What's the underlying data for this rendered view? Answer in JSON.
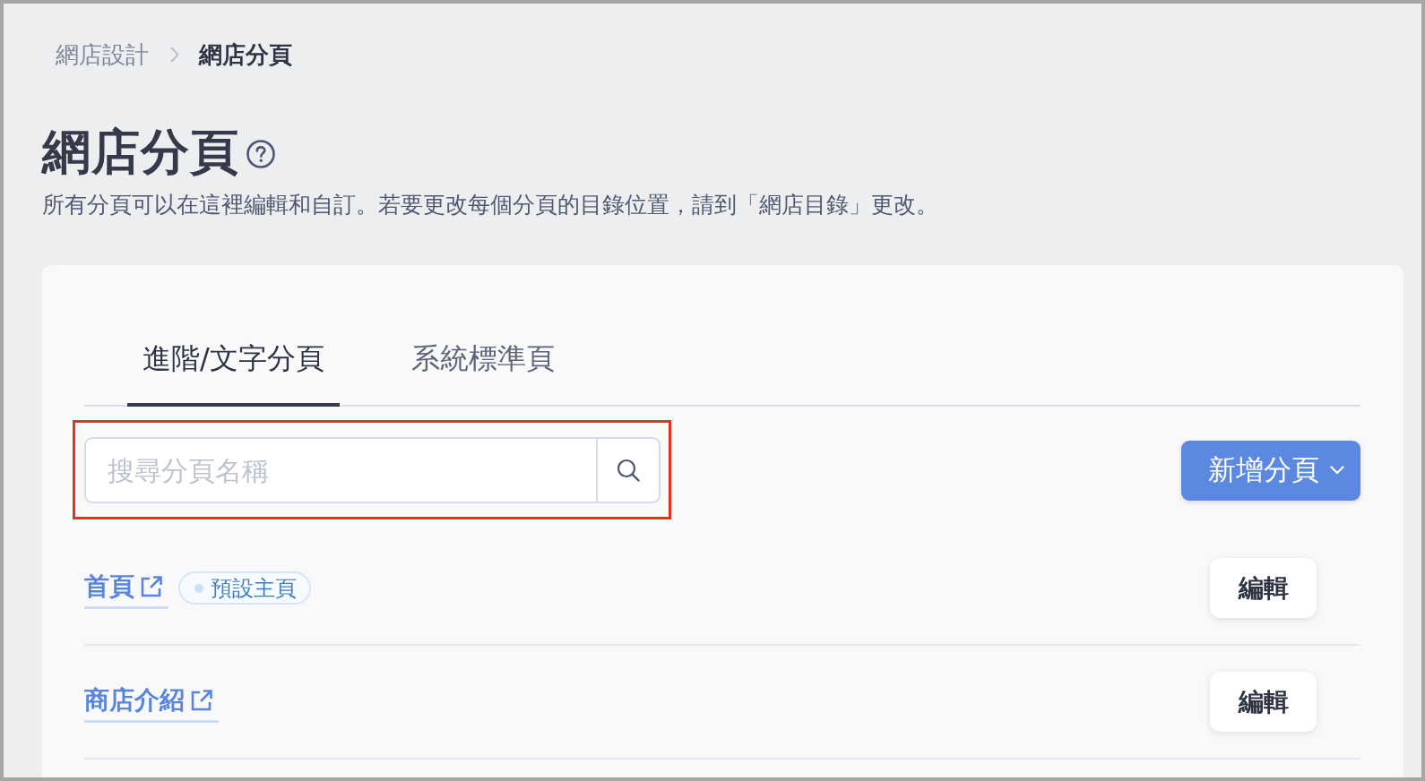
{
  "breadcrumb": [
    {
      "label": "網店設計",
      "current": false
    },
    {
      "label": "網店分頁",
      "current": true
    }
  ],
  "page": {
    "title": "網店分頁",
    "description": "所有分頁可以在這裡編輯和自訂。若要更改每個分頁的目錄位置，請到「網店目錄」更改。"
  },
  "tabs": [
    {
      "label": "進階/文字分頁",
      "selected": true
    },
    {
      "label": "系統標準頁",
      "selected": false
    }
  ],
  "search": {
    "placeholder": "搜尋分頁名稱",
    "highlighted": true
  },
  "add_button": {
    "label": "新增分頁"
  },
  "pages": [
    {
      "name": "首頁",
      "badge": "預設主頁",
      "edit_label": "編輯"
    },
    {
      "name": "商店介紹",
      "edit_label": "編輯"
    }
  ]
}
